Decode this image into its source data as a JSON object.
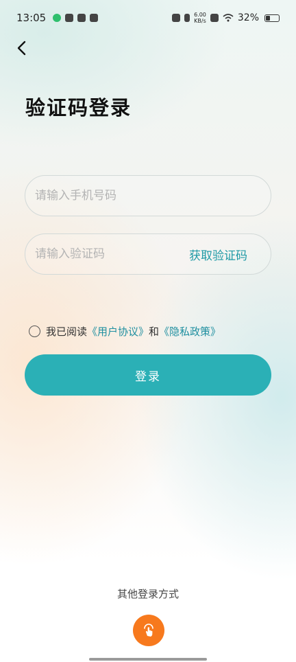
{
  "status_bar": {
    "time": "13:05",
    "net_speed_value": "6.00",
    "net_speed_unit": "KB/s",
    "battery": "32%"
  },
  "header": {
    "back_icon": "chevron-left-icon"
  },
  "title": "验证码登录",
  "form": {
    "phone_placeholder": "请输入手机号码",
    "phone_value": "",
    "code_placeholder": "请输入验证码",
    "code_value": "",
    "get_code_label": "获取验证码"
  },
  "agreement": {
    "prefix": "我已阅读",
    "user_agreement": "《用户协议》",
    "conjunction": "和",
    "privacy_policy": "《隐私政策》",
    "checked": false
  },
  "login_button_label": "登录",
  "other_login": {
    "label": "其他登录方式",
    "icon": "hand-tap-icon"
  },
  "colors": {
    "accent": "#2bb0b6",
    "link": "#1f8fa0",
    "alt_login": "#f7791d"
  }
}
